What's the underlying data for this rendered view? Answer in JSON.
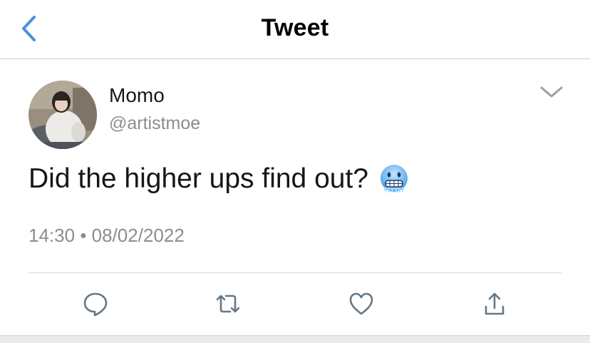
{
  "header": {
    "title": "Tweet",
    "back_icon": "chevron-left-icon",
    "accent_color": "#4a90e2"
  },
  "tweet": {
    "author_name": "Momo",
    "author_handle": "@artistmoe",
    "text": "Did the higher ups find out?",
    "emoji": "cold-face-emoji",
    "time": "14:30",
    "separator": "•",
    "date": "08/02/2022"
  },
  "actions": [
    {
      "name": "reply",
      "icon": "comment-icon"
    },
    {
      "name": "retweet",
      "icon": "retweet-icon"
    },
    {
      "name": "like",
      "icon": "heart-icon"
    },
    {
      "name": "share",
      "icon": "share-icon"
    }
  ],
  "colors": {
    "secondary_text": "#8a8d91",
    "icon_gray": "#657786",
    "divider": "#d4d6d9"
  }
}
